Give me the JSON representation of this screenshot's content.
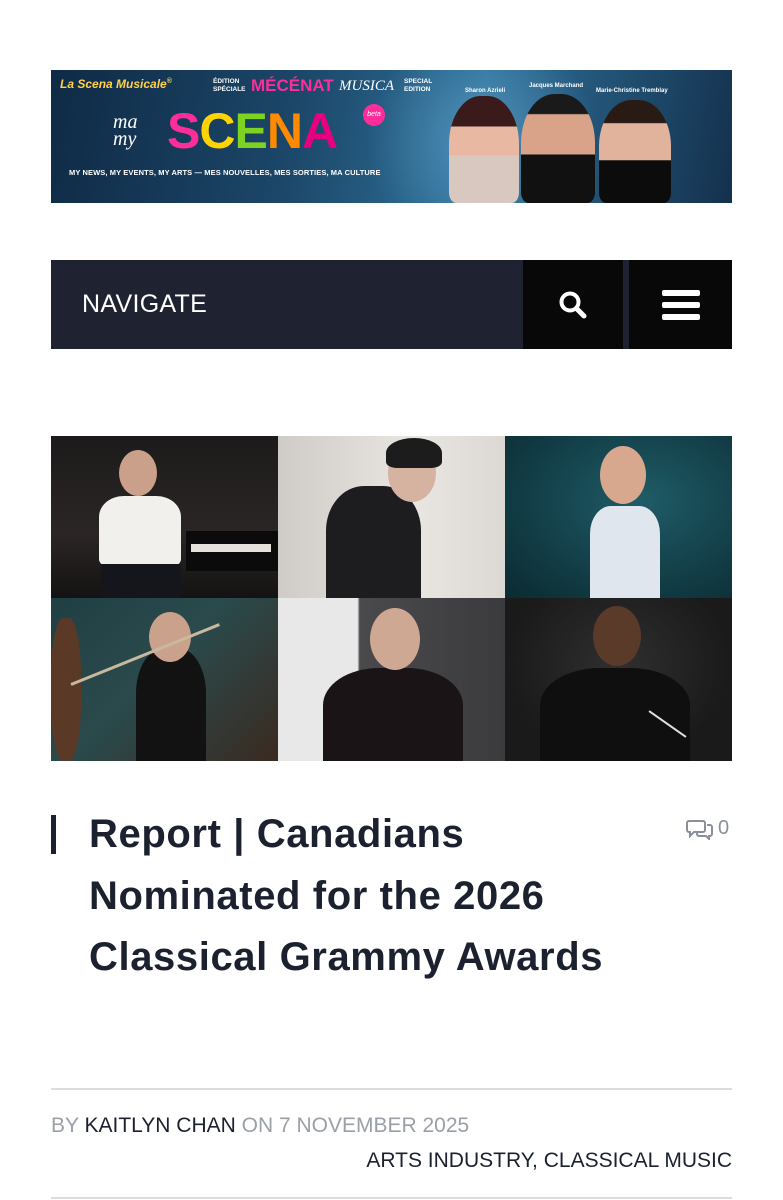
{
  "banner": {
    "brand": "La Scena Musicale",
    "brand_mark": "®",
    "edition_left_1": "ÉDITION",
    "edition_left_2": "SPÉCIALE",
    "mecenat": "MÉCÉNAT",
    "musica": "MUSICA",
    "edition_right_1": "SPECIAL",
    "edition_right_2": "EDITION",
    "ma_my_1": "ma",
    "ma_my_2": "my",
    "scena_letters": [
      "S",
      "C",
      "E",
      "N",
      "A"
    ],
    "beta": "beta",
    "tagline": "MY NEWS, MY EVENTS, MY ARTS — MES NOUVELLES, MES SORTIES, MA CULTURE",
    "people": [
      "Sharon Azrieli",
      "Jacques Marchand",
      "Marie-Christine Tremblay"
    ]
  },
  "nav": {
    "label": "NAVIGATE",
    "search_icon": "search-icon",
    "menu_icon": "hamburger-menu-icon"
  },
  "article": {
    "title": "Report | Canadians Nominated for the 2026 Classical Grammy Awards",
    "comment_count": "0",
    "comment_icon": "comment-bubbles-icon",
    "by_prefix": "BY ",
    "author": "KAITLYN CHAN",
    "on_prefix": " ON ",
    "date": "7 NOVEMBER 2025",
    "categories": [
      "ARTS INDUSTRY",
      "CLASSICAL MUSIC"
    ],
    "category_separator": ", "
  },
  "colors": {
    "nav_bg": "#1f2331",
    "nav_button_bg": "#080808",
    "text_dark": "#1c2130",
    "text_muted": "#9aa0a8"
  }
}
